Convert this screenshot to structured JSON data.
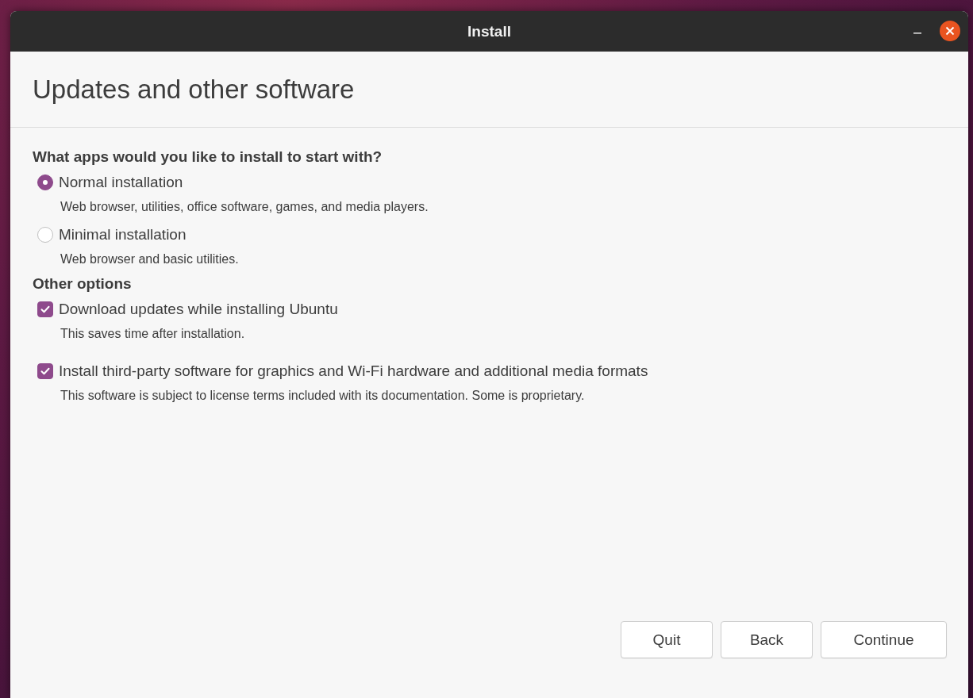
{
  "window": {
    "title": "Install"
  },
  "page_title": "Updates and other software",
  "sections": [
    {
      "heading": "What apps would you like to install to start with?",
      "options": [
        {
          "kind": "radio",
          "label": "Normal installation",
          "description": "Web browser, utilities, office software, games, and media players.",
          "selected": true
        },
        {
          "kind": "radio",
          "label": "Minimal installation",
          "description": "Web browser and basic utilities.",
          "selected": false
        }
      ]
    },
    {
      "heading": "Other options",
      "options": [
        {
          "kind": "checkbox",
          "label": "Download updates while installing Ubuntu",
          "description": "This saves time after installation.",
          "checked": true
        },
        {
          "kind": "checkbox",
          "label": "Install third-party software for graphics and Wi-Fi hardware and additional media formats",
          "description": "This software is subject to license terms included with its documentation. Some is proprietary.",
          "checked": true
        }
      ]
    }
  ],
  "buttons": [
    "Quit",
    "Back",
    "Continue"
  ]
}
